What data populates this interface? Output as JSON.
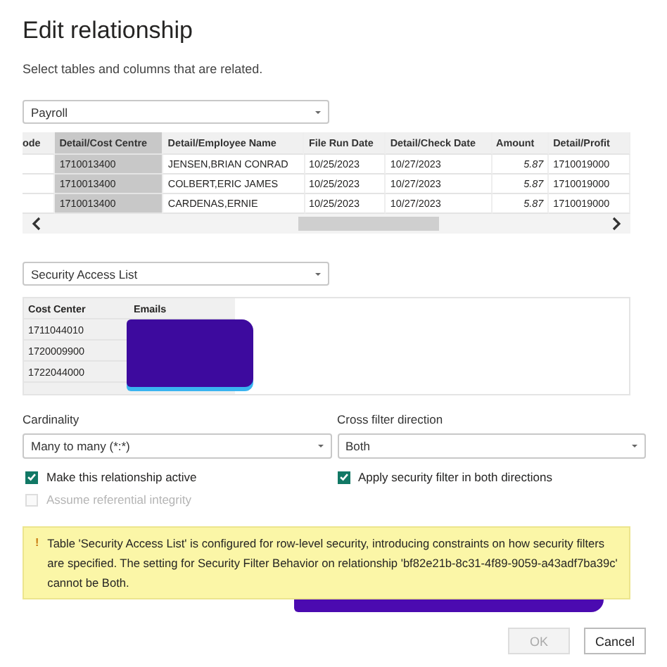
{
  "dialog": {
    "title": "Edit relationship",
    "subtitle": "Select tables and columns that are related."
  },
  "table_1": {
    "dropdown": "Payroll",
    "columns": [
      {
        "label": "ode",
        "selected": false
      },
      {
        "label": "Detail/Cost Centre",
        "selected": true
      },
      {
        "label": "Detail/Employee Name",
        "selected": false
      },
      {
        "label": "File Run Date",
        "selected": false
      },
      {
        "label": "Detail/Check Date",
        "selected": false
      },
      {
        "label": "Amount",
        "selected": false
      },
      {
        "label": "Detail/Profit",
        "selected": false
      }
    ],
    "rows": [
      [
        "",
        "1710013400",
        "JENSEN,BRIAN CONRAD",
        "10/25/2023",
        "10/27/2023",
        "5.87",
        "1710019000"
      ],
      [
        "",
        "1710013400",
        "COLBERT,ERIC JAMES",
        "10/25/2023",
        "10/27/2023",
        "5.87",
        "1710019000"
      ],
      [
        "",
        "1710013400",
        "CARDENAS,ERNIE",
        "10/25/2023",
        "10/27/2023",
        "5.87",
        "1710019000"
      ]
    ]
  },
  "table_2": {
    "dropdown": "Security Access List",
    "columns": [
      {
        "label": "Cost Center",
        "selected": false
      },
      {
        "label": "Emails",
        "selected": false
      }
    ],
    "rows": [
      [
        "1711044010",
        ""
      ],
      [
        "1720009900",
        ""
      ],
      [
        "1722044000",
        ""
      ]
    ]
  },
  "cardinality": {
    "label": "Cardinality",
    "value": "Many to many (*:*)"
  },
  "cross_filter": {
    "label": "Cross filter direction",
    "value": "Both"
  },
  "checkboxes": [
    {
      "label": "Make this relationship active",
      "checked": true,
      "disabled": false
    },
    {
      "label": "Apply security filter in both directions",
      "checked": true,
      "disabled": false
    },
    {
      "label": "Assume referential integrity",
      "checked": false,
      "disabled": true
    }
  ],
  "warning": {
    "icon": "!",
    "text": "Table 'Security Access List' is configured for row-level security, introducing constraints on how security filters are specified. The setting for Security Filter Behavior on relationship 'bf82e21b-8c31-4f89-9059-a43adf7ba39c' cannot be Both."
  },
  "buttons": [
    {
      "label": "OK",
      "disabled": true
    },
    {
      "label": "Cancel",
      "disabled": false
    }
  ]
}
